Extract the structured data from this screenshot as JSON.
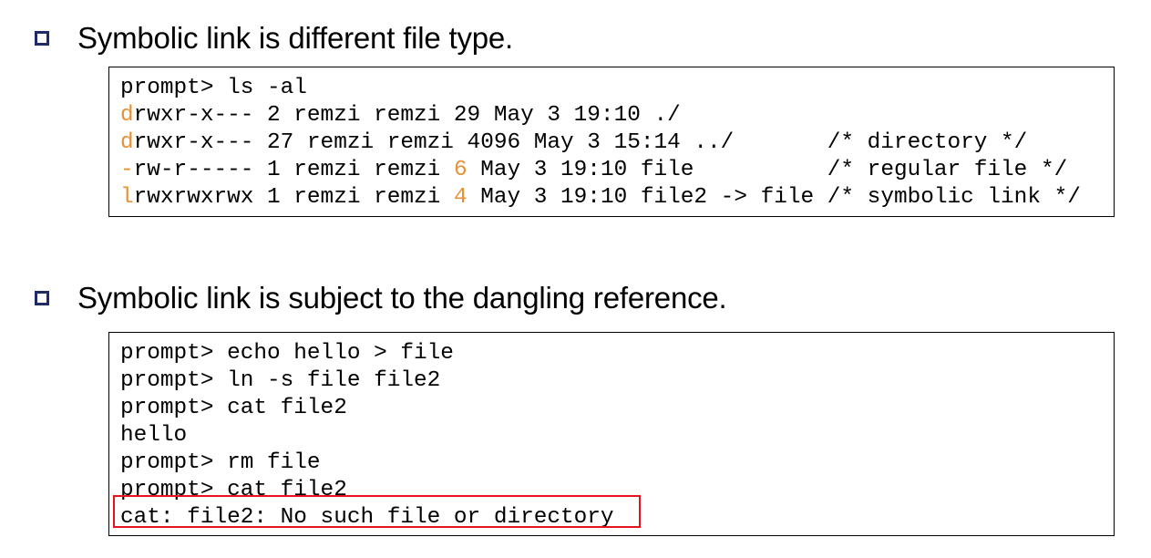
{
  "bullets": [
    {
      "text": "Symbolic link is different file type."
    },
    {
      "text": "Symbolic link is subject to the dangling reference."
    }
  ],
  "listing": {
    "lines": [
      {
        "segments": [
          {
            "text": "prompt> ls -al",
            "hl": false
          }
        ]
      },
      {
        "segments": [
          {
            "text": "d",
            "hl": true
          },
          {
            "text": "rwxr-x--- 2 remzi remzi 29 May 3 19:10 ./",
            "hl": false
          }
        ]
      },
      {
        "segments": [
          {
            "text": "d",
            "hl": true
          },
          {
            "text": "rwxr-x--- 27 remzi remzi 4096 May 3 15:14 ../       /* directory */",
            "hl": false
          }
        ]
      },
      {
        "segments": [
          {
            "text": "-",
            "hl": true
          },
          {
            "text": "rw-r----- 1 remzi remzi ",
            "hl": false
          },
          {
            "text": "6",
            "hl": true
          },
          {
            "text": " May 3 19:10 file          /* regular file */",
            "hl": false
          }
        ]
      },
      {
        "segments": [
          {
            "text": "l",
            "hl": true
          },
          {
            "text": "rwxrwxrwx 1 remzi remzi ",
            "hl": false
          },
          {
            "text": "4",
            "hl": true
          },
          {
            "text": " May 3 19:10 file2 -> file /* symbolic link */",
            "hl": false
          }
        ]
      }
    ]
  },
  "dangling": {
    "lines": [
      {
        "segments": [
          {
            "text": "prompt> echo hello > file",
            "hl": false
          }
        ]
      },
      {
        "segments": [
          {
            "text": "prompt> ln -s file file2",
            "hl": false
          }
        ]
      },
      {
        "segments": [
          {
            "text": "prompt> cat file2",
            "hl": false
          }
        ]
      },
      {
        "segments": [
          {
            "text": "hello",
            "hl": false
          }
        ]
      },
      {
        "segments": [
          {
            "text": "prompt> rm file",
            "hl": false
          }
        ]
      },
      {
        "segments": [
          {
            "text": "prompt> cat file2",
            "hl": false
          }
        ]
      },
      {
        "segments": [
          {
            "text": "cat: file2: No such file or directory",
            "hl": false
          }
        ]
      }
    ],
    "highlighted_line": "cat: file2: No such file or directory"
  },
  "colors": {
    "accent": "#e69138",
    "bullet": "#1f2a66",
    "highlight_box": "#e8121e"
  }
}
